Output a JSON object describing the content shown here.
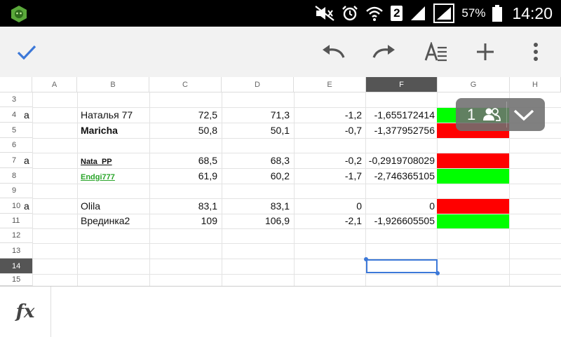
{
  "status_bar": {
    "battery_percent": "57%",
    "time": "14:20",
    "sim_slot": "2"
  },
  "toolbar": {
    "icons": [
      "check-icon",
      "undo-icon",
      "redo-icon",
      "text-format-icon",
      "plus-icon",
      "more-vert-icon"
    ]
  },
  "sheet": {
    "columns": [
      "A",
      "B",
      "C",
      "D",
      "E",
      "F",
      "G",
      "H"
    ],
    "selected_column": "F",
    "selected_row": "14",
    "rows": [
      {
        "num": "3",
        "a": "",
        "b": "",
        "c": "",
        "d": "",
        "e": "",
        "f": "",
        "fill": ""
      },
      {
        "num": "4",
        "a": "а",
        "b": "Наталья 77",
        "c": "72,5",
        "d": "71,3",
        "e": "-1,2",
        "f": "-1,655172414",
        "fill": "#00ff00"
      },
      {
        "num": "5",
        "a": "",
        "b": "Maricha",
        "c": "50,8",
        "d": "50,1",
        "e": "-0,7",
        "f": "-1,377952756",
        "fill": "#ff0000"
      },
      {
        "num": "6",
        "a": "",
        "b": "",
        "c": "",
        "d": "",
        "e": "",
        "f": "",
        "fill": ""
      },
      {
        "num": "7",
        "a": "а",
        "b": "Nata_PP",
        "c": "68,5",
        "d": "68,3",
        "e": "-0,2",
        "f": "-0,2919708029",
        "fill": "#ff0000"
      },
      {
        "num": "8",
        "a": "",
        "b": "Endgi777",
        "c": "61,9",
        "d": "60,2",
        "e": "-1,7",
        "f": "-2,746365105",
        "fill": "#00ff00"
      },
      {
        "num": "9",
        "a": "",
        "b": "",
        "c": "",
        "d": "",
        "e": "",
        "f": "",
        "fill": ""
      },
      {
        "num": "10",
        "a": "а",
        "b": "Olila",
        "c": "83,1",
        "d": "83,1",
        "e": "0",
        "f": "0",
        "fill": "#ff0000"
      },
      {
        "num": "11",
        "a": "",
        "b": "Врединка2",
        "c": "109",
        "d": "106,9",
        "e": "-2,1",
        "f": "-1,926605505",
        "fill": "#00ff00"
      },
      {
        "num": "12",
        "a": "",
        "b": "",
        "c": "",
        "d": "",
        "e": "",
        "f": "",
        "fill": ""
      },
      {
        "num": "13",
        "a": "",
        "b": "",
        "c": "",
        "d": "",
        "e": "",
        "f": "",
        "fill": ""
      },
      {
        "num": "14",
        "a": "",
        "b": "",
        "c": "",
        "d": "",
        "e": "",
        "f": "",
        "fill": ""
      },
      {
        "num": "15",
        "a": "",
        "b": "",
        "c": "",
        "d": "",
        "e": "",
        "f": "",
        "fill": ""
      }
    ]
  },
  "collaborators": {
    "count": "1"
  },
  "formula_bar": {
    "fx_label": "fx",
    "value": ""
  }
}
